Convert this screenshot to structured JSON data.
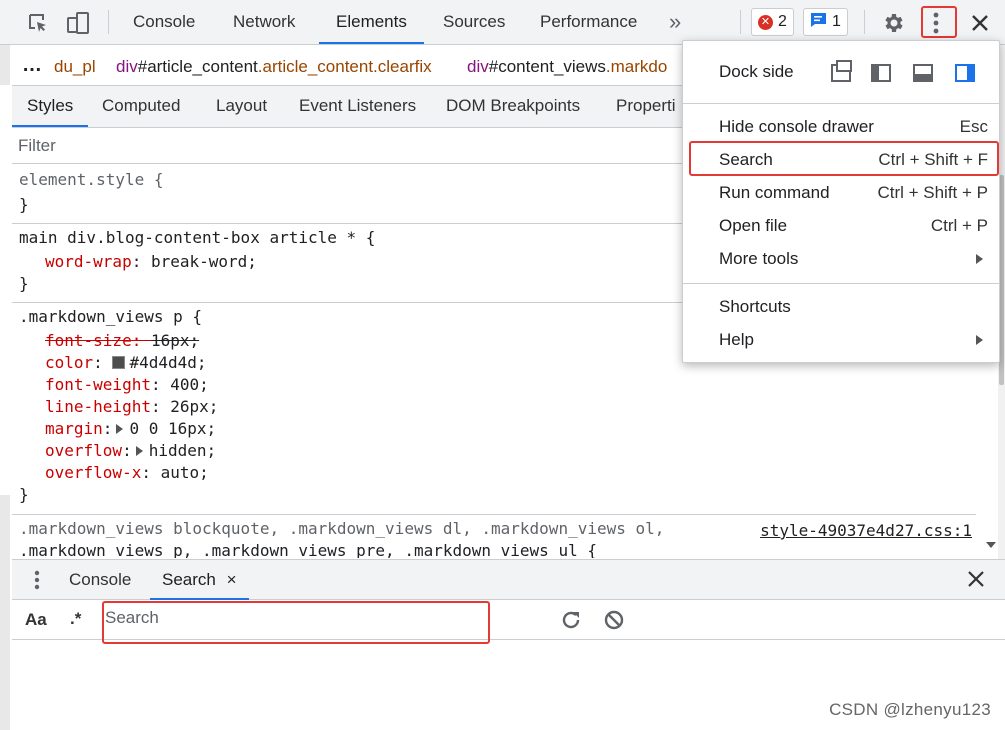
{
  "toolbar": {
    "tabs": [
      "Console",
      "Network",
      "Elements",
      "Sources",
      "Performance"
    ],
    "overflow": "»",
    "errors_count": "2",
    "messages_count": "1"
  },
  "breadcrumb": {
    "more": "…",
    "items": [
      {
        "tag": "",
        "cls": "du_pl"
      },
      {
        "tag": "div",
        "id": "#article_content",
        "cls": ".article_content.clearfix"
      },
      {
        "tag": "div",
        "id": "#content_views",
        "cls": ".markdo"
      }
    ]
  },
  "subtabs": [
    "Styles",
    "Computed",
    "Layout",
    "Event Listeners",
    "DOM Breakpoints",
    "Properti"
  ],
  "filter": {
    "placeholder": "Filter"
  },
  "styles": {
    "rule1": {
      "selector": "element.style {",
      "close": "}"
    },
    "rule2": {
      "selector": "main div.blog-content-box article * {",
      "prop": "word-wrap",
      "value": "break-word;",
      "close": "}"
    },
    "rule3": {
      "selector": ".markdown_views p {",
      "props": [
        {
          "name": "font-size",
          "value": "16px;"
        },
        {
          "name": "color",
          "value": "#4d4d4d;"
        },
        {
          "name": "font-weight",
          "value": "400;"
        },
        {
          "name": "line-height",
          "value": "26px;"
        },
        {
          "name": "margin",
          "value": "0 0 16px;"
        },
        {
          "name": "overflow",
          "value": "hidden;"
        },
        {
          "name": "overflow-x",
          "value": "auto;"
        }
      ],
      "close": "}"
    },
    "rule4": {
      "selector_line1": ".markdown_views blockquote, .markdown_views dl, .markdown_views ol,",
      "selector_line2": ".markdown_views p, .markdown_views pre, .markdown_views ul {",
      "source": "style-49037e4d27.css:1"
    },
    "colors": {
      "swatch": "#4d4d4d",
      "property": "#c80000"
    }
  },
  "menu": {
    "dock_label": "Dock side",
    "items": [
      {
        "label": "Hide console drawer",
        "shortcut": "Esc"
      },
      {
        "label": "Search",
        "shortcut": "Ctrl + Shift + F"
      },
      {
        "label": "Run command",
        "shortcut": "Ctrl + Shift + P"
      },
      {
        "label": "Open file",
        "shortcut": "Ctrl + P"
      },
      {
        "label": "More tools",
        "shortcut": ""
      },
      {
        "label": "Shortcuts",
        "shortcut": ""
      },
      {
        "label": "Help",
        "shortcut": ""
      }
    ]
  },
  "drawer": {
    "tabs": [
      "Console",
      "Search"
    ],
    "close": "×",
    "match_case": "Aa",
    "regex": ".*",
    "search_placeholder": "Search"
  },
  "watermark": "CSDN @lzhenyu123",
  "accent": "#1a73e8",
  "highlight": "#e53935"
}
